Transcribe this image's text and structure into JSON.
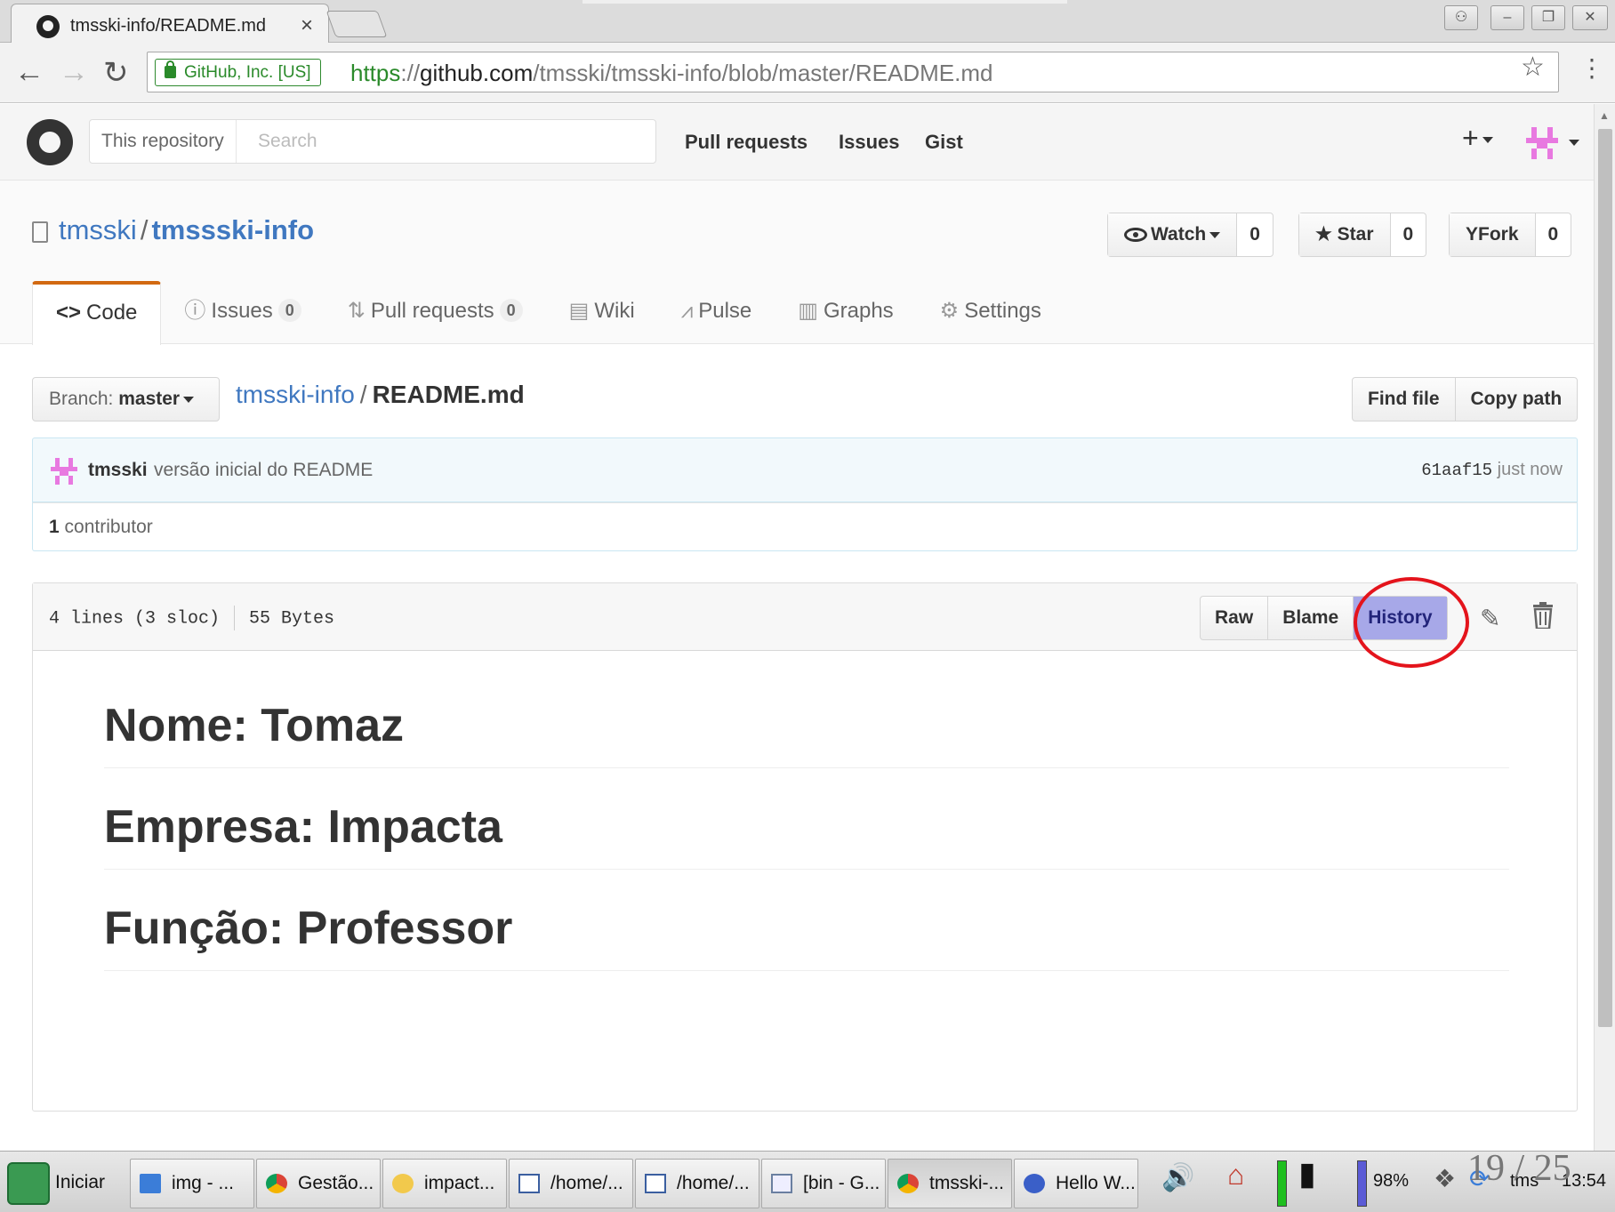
{
  "browser": {
    "tab_title": "tmsski-info/README.md",
    "tab_close": "×",
    "ev_label": "GitHub, Inc. [US]",
    "url_scheme": "https",
    "url_sep": "://",
    "url_host": "github.com",
    "url_path": "/tmsski/tmsski-info/blob/master/README.md",
    "back": "←",
    "forward": "→",
    "reload": "↻",
    "star": "☆",
    "menu": "⋮"
  },
  "gh_header": {
    "search_scope": "This repository",
    "search_placeholder": "Search",
    "nav": [
      "Pull requests",
      "Issues",
      "Gist"
    ],
    "plus": "+"
  },
  "repo": {
    "owner": "tmsski",
    "separator": "/",
    "name": "tmssski-info",
    "watch_label": "Watch",
    "watch_count": "0",
    "star_label": "Star",
    "star_icon": "★",
    "star_count": "0",
    "fork_label": "Fork",
    "fork_icon": "Y",
    "fork_count": "0"
  },
  "reponav": [
    {
      "icon": "<>",
      "label": "Code",
      "counter": ""
    },
    {
      "icon": "ⓘ",
      "label": "Issues",
      "counter": "0"
    },
    {
      "icon": "⇅",
      "label": "Pull requests",
      "counter": "0"
    },
    {
      "icon": "▤",
      "label": "Wiki",
      "counter": ""
    },
    {
      "icon": "⩘",
      "label": "Pulse",
      "counter": ""
    },
    {
      "icon": "▥",
      "label": "Graphs",
      "counter": ""
    },
    {
      "icon": "⚙",
      "label": "Settings",
      "counter": ""
    }
  ],
  "file_nav": {
    "branch_prefix": "Branch:",
    "branch_name": "master",
    "breadcrumb_root": "tmsski-info",
    "breadcrumb_sep": "/",
    "breadcrumb_file": "README.md",
    "find_file": "Find file",
    "copy_path": "Copy path"
  },
  "commit": {
    "author": "tmsski",
    "message": "versão inicial do README",
    "sha": "61aaf15",
    "time": "just now",
    "contributors_count": "1",
    "contributors_label": "contributor"
  },
  "file": {
    "lines": "4 lines (3 sloc)",
    "size": "55 Bytes",
    "raw": "Raw",
    "blame": "Blame",
    "history": "History",
    "pencil": "✎",
    "headings": [
      "Nome: Tomaz",
      "Empresa: Impacta",
      "Função: Professor"
    ]
  },
  "taskbar": {
    "start": "Iniciar",
    "tasks": [
      "img - ...",
      "Gestão...",
      "impact...",
      "/home/...",
      "/home/...",
      "[bin - G...",
      "tmsski-...",
      "Hello W..."
    ],
    "battery": "98%",
    "user": "tms",
    "clock": "13:54"
  },
  "page_counter": "19 / 25",
  "colors": {
    "link": "#4078c0",
    "nav_accent": "#d26911",
    "history_highlight": "#a7a8e8",
    "annotation_ring": "#e4141c",
    "ev_green": "#2a8a2a"
  }
}
